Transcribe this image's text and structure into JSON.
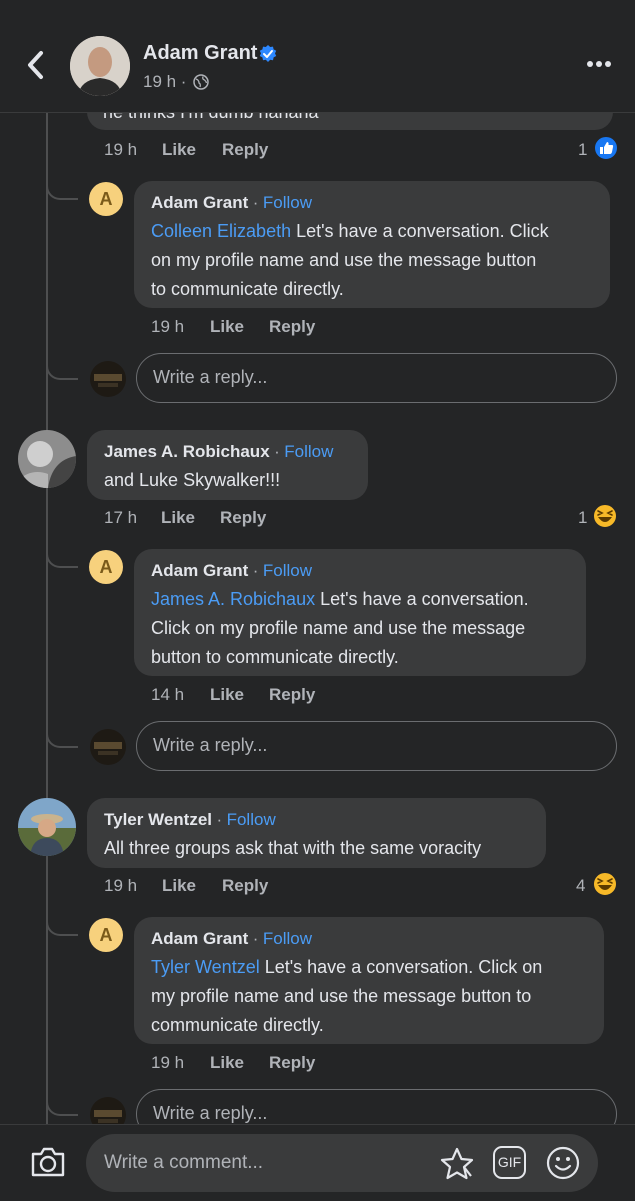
{
  "header": {
    "name": "Adam Grant",
    "time": "19 h ·"
  },
  "comment_top": {
    "text_partial": "he thinks I'm dumb hahaha",
    "time": "19 h",
    "like": "Like",
    "reply": "Reply",
    "reaction_count": "1"
  },
  "reply1": {
    "avatar_letter": "A",
    "author": "Adam Grant",
    "dot": "·",
    "follow": "Follow",
    "mention": "Colleen Elizabeth",
    "text_line1": " Let's have a conversation. Click",
    "text_line2": "on my profile name and use the message button",
    "text_line3": "to communicate directly.",
    "time": "19 h",
    "like": "Like",
    "reply": "Reply"
  },
  "reply_box1": {
    "placeholder": "Write a reply..."
  },
  "comment2": {
    "author": "James A. Robichaux",
    "dot": "·",
    "follow": "Follow",
    "text": "and Luke Skywalker!!!",
    "time": "17 h",
    "like": "Like",
    "reply": "Reply",
    "reaction_count": "1"
  },
  "reply2": {
    "avatar_letter": "A",
    "author": "Adam Grant",
    "dot": "·",
    "follow": "Follow",
    "mention": "James A. Robichaux",
    "text_line1": " Let's have a conversation.",
    "text_line2": "Click on my profile name and use the message",
    "text_line3": "button to communicate directly.",
    "time": "14 h",
    "like": "Like",
    "reply": "Reply"
  },
  "reply_box2": {
    "placeholder": "Write a reply..."
  },
  "comment3": {
    "author": "Tyler Wentzel",
    "dot": "·",
    "follow": "Follow",
    "text": "All three groups ask that with the same voracity",
    "time": "19 h",
    "like": "Like",
    "reply": "Reply",
    "reaction_count": "4"
  },
  "reply3": {
    "avatar_letter": "A",
    "author": "Adam Grant",
    "dot": "·",
    "follow": "Follow",
    "mention": "Tyler Wentzel",
    "text_line1": " Let's have a conversation. Click on",
    "text_line2": "my profile name and use the message button to",
    "text_line3": "communicate directly.",
    "time": "19 h",
    "like": "Like",
    "reply": "Reply"
  },
  "reply_box3": {
    "placeholder": "Write a reply..."
  },
  "composer": {
    "placeholder": "Write a comment...",
    "gif_label": "GIF"
  },
  "colors": {
    "background": "#242526",
    "bubble": "#3a3b3c",
    "link": "#4b9cf5",
    "verified": "#2d88ff",
    "like_reaction": "#1877f2",
    "haha_reaction": "#f7b928"
  }
}
